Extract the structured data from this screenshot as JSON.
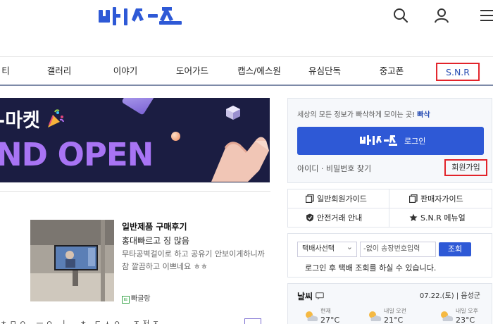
{
  "header": {
    "logo_text": "빠삭",
    "icons": [
      "search-icon",
      "user-icon",
      "menu-icon"
    ]
  },
  "nav": {
    "items": [
      {
        "label": "티"
      },
      {
        "label": "갤러리"
      },
      {
        "label": "이야기"
      },
      {
        "label": "도어가드"
      },
      {
        "label": "캡스/에스원"
      },
      {
        "label": "유심단독"
      },
      {
        "label": "중고폰"
      },
      {
        "label": "S.N.R"
      }
    ]
  },
  "banner": {
    "title": "-마켓",
    "subtitle": "ND OPEN"
  },
  "review": {
    "title": "일반제품 구매후기",
    "subtitle": "홍대빠르고 징 많음",
    "body": "무타공벽걸이로 하고 공유기 안보이게하니까 참 깔끔하고 이쁘네요 ㅎㅎ",
    "source": "빠글랑",
    "source_badge": "ㅌ"
  },
  "cutoff_row_text": "ㅊ ㅁ ㅇ...  ㅡ ㅇ...ㅣ ...  ㅊ...ㄷ ㅅ  ㅇ ...                  ㅈ 저 ㅈ",
  "login": {
    "info_prefix": "세상의 모든 정보가 빠삭하게 모이는 곳!",
    "info_brand": "빠삭",
    "button_logo": "빠삭",
    "button_label": "로그인",
    "find_link": "아이디 · 비밀번호 찾기",
    "join_link": "회원가입"
  },
  "guides": [
    {
      "label": "일반회원가이드",
      "icon": "document-copy-icon"
    },
    {
      "label": "판매자가이드",
      "icon": "document-copy-icon"
    },
    {
      "label": "안전거래 안내",
      "icon": "shield-icon"
    },
    {
      "label": "S.N.R 메뉴얼",
      "icon": "star-icon"
    }
  ],
  "tracking": {
    "select_value": "택배사선택",
    "input_placeholder": "-없이 송장번호입력",
    "button_label": "조회",
    "note": "로그인 후 택배 조회를 하실 수 있습니다."
  },
  "weather": {
    "title": "날씨",
    "date": "07.22.(토) | 음성군",
    "columns": [
      {
        "label": "현재",
        "temp": "27°C"
      },
      {
        "label": "내일 오전",
        "temp": "21°C"
      },
      {
        "label": "내일 오후",
        "temp": "23°C"
      }
    ]
  },
  "colors": {
    "brand_blue": "#2e59d6",
    "highlight_red": "#e2232a",
    "banner_bg": "#1b1d42",
    "banner_accent": "#a874f4"
  }
}
